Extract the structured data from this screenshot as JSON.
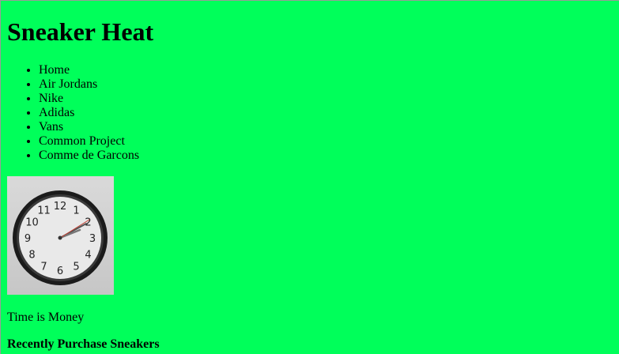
{
  "page": {
    "title": "Sneaker Heat",
    "background_color": "#00ff5a"
  },
  "nav": {
    "items": [
      {
        "label": "Home"
      },
      {
        "label": "Air Jordans"
      },
      {
        "label": "Nike"
      },
      {
        "label": "Adidas"
      },
      {
        "label": "Vans"
      },
      {
        "label": "Common Project"
      },
      {
        "label": "Comme de Garcons"
      }
    ]
  },
  "hero": {
    "image_icon": "wall-clock-icon",
    "clock_numbers": [
      "12",
      "1",
      "2",
      "3",
      "4",
      "5",
      "6",
      "7",
      "8",
      "9",
      "10",
      "11"
    ]
  },
  "tagline": "Time is Money",
  "recent": {
    "heading": "Recently Purchase Sneakers"
  }
}
